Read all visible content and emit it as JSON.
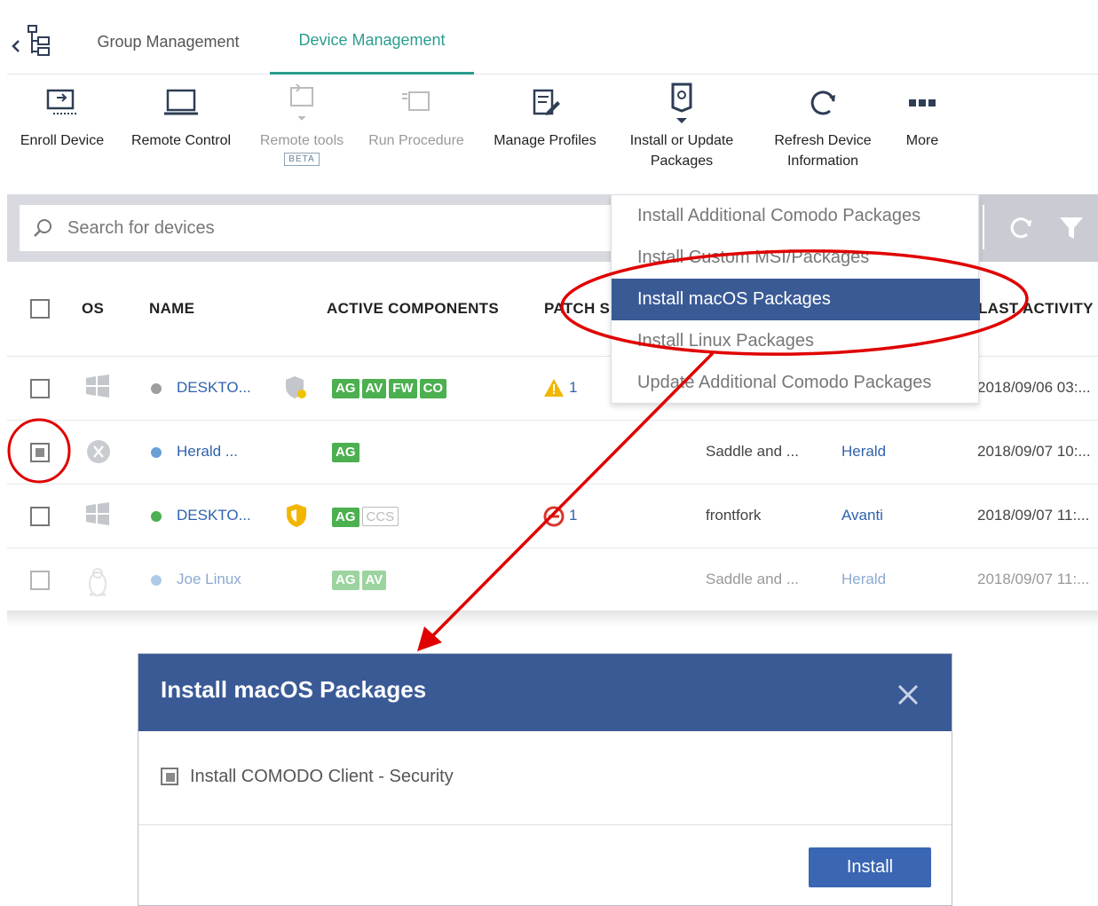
{
  "tabs": [
    {
      "label": "Group Management",
      "active": false
    },
    {
      "label": "Device Management",
      "active": true
    }
  ],
  "toolbar": {
    "enroll": "Enroll Device",
    "remote_control": "Remote Control",
    "remote_tools": "Remote tools",
    "beta": "BETA",
    "run_procedure": "Run Procedure",
    "manage_profiles": "Manage Profiles",
    "install_line1": "Install or Update",
    "install_line2": "Packages",
    "refresh_line1": "Refresh Device",
    "refresh_line2": "Information",
    "more": "More"
  },
  "search": {
    "placeholder": "Search for devices"
  },
  "table": {
    "headers": {
      "os": "OS",
      "name": "NAME",
      "components": "ACTIVE COMPONENTS",
      "patch": "PATCH S",
      "last_activity": "LAST ACTIVITY"
    },
    "rows": [
      {
        "os": "windows",
        "status_color": "#9e9e9e",
        "name": "DESKTO...",
        "shield": "shield-warning",
        "components": [
          "AG",
          "AV",
          "FW",
          "CO"
        ],
        "disabled_components": [],
        "patch_icon": "warning",
        "patch_count": "1",
        "company": "",
        "group": "",
        "last_activity": "2018/09/06 03:..."
      },
      {
        "os": "macos",
        "status_color": "#6aa0d8",
        "name": "Herald ...",
        "shield": "",
        "components": [
          "AG"
        ],
        "disabled_components": [],
        "patch_icon": "",
        "patch_count": "",
        "company": "Saddle and ...",
        "group": "Herald",
        "last_activity": "2018/09/07 10:..."
      },
      {
        "os": "windows",
        "status_color": "#4caf50",
        "name": "DESKTO...",
        "shield": "shield-alert",
        "components": [
          "AG"
        ],
        "disabled_components": [
          "CCS"
        ],
        "patch_icon": "error",
        "patch_count": "1",
        "company": "frontfork",
        "group": "Avanti",
        "last_activity": "2018/09/07 11:..."
      },
      {
        "os": "linux",
        "status_color": "#6aa0d8",
        "name": "Joe Linux",
        "shield": "",
        "components": [
          "AG",
          "AV"
        ],
        "disabled_components": [],
        "patch_icon": "",
        "patch_count": "",
        "company": "Saddle and ...",
        "group": "Herald",
        "last_activity": "2018/09/07 11:..."
      }
    ]
  },
  "menu": {
    "items": [
      {
        "label": "Install Additional Comodo Packages",
        "selected": false
      },
      {
        "label": "Install Custom MSI/Packages",
        "selected": false
      },
      {
        "label": "Install macOS Packages",
        "selected": true
      },
      {
        "label": "Install Linux Packages",
        "selected": false
      },
      {
        "label": "Update Additional Comodo Packages",
        "selected": false
      }
    ]
  },
  "dialog": {
    "title": "Install macOS Packages",
    "option_label": "Install COMODO Client - Security",
    "install_button": "Install"
  },
  "colors": {
    "accent_teal": "#2a9d8f",
    "header_blue": "#3a5a96",
    "annotation_red": "#e00000",
    "badge_green": "#4caf50"
  }
}
